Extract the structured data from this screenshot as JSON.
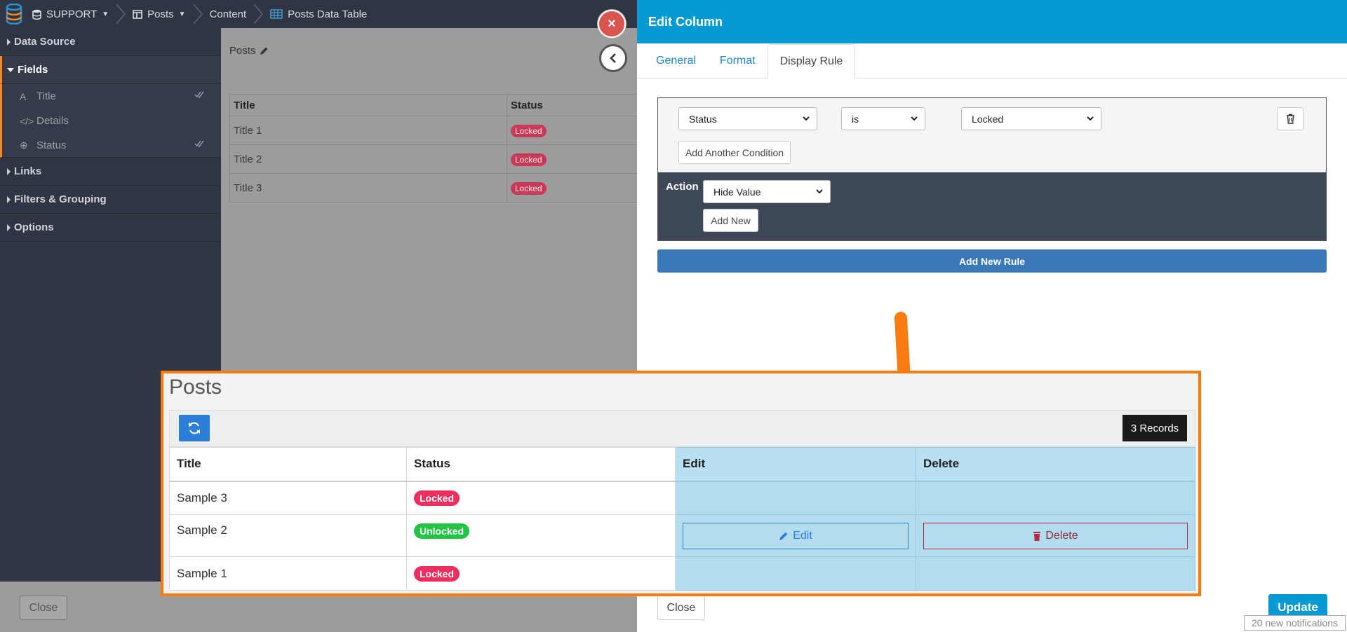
{
  "breadcrumb": {
    "app": "SUPPORT",
    "module": "Posts",
    "section": "Content",
    "page": "Posts Data Table"
  },
  "sidebar": {
    "data_source": "Data Source",
    "fields": "Fields",
    "field_items": [
      "Title",
      "Details",
      "Status"
    ],
    "links": "Links",
    "filters": "Filters & Grouping",
    "options": "Options"
  },
  "canvas": {
    "title": "Posts",
    "headers": [
      "Title",
      "Status"
    ],
    "rows": [
      {
        "title": "Title 1",
        "status": "Locked"
      },
      {
        "title": "Title 2",
        "status": "Locked"
      },
      {
        "title": "Title 3",
        "status": "Locked"
      }
    ],
    "close_label": "Close"
  },
  "panel": {
    "title": "Edit Column",
    "tabs": [
      "General",
      "Format",
      "Display Rule"
    ],
    "active_tab": "Display Rule",
    "condition_field": "Status",
    "condition_operator": "is",
    "condition_value": "Locked",
    "add_condition": "Add Another Condition",
    "action_label": "Action",
    "action_value": "Hide Value",
    "add_new": "Add New",
    "add_rule": "Add New Rule",
    "close_label": "Close",
    "update_label": "Update",
    "notifications": "20 new notifications"
  },
  "preview": {
    "title": "Posts",
    "records": "3 Records",
    "headers": [
      "Title",
      "Status",
      "Edit",
      "Delete"
    ],
    "rows": [
      {
        "title": "Sample 3",
        "status": "Locked"
      },
      {
        "title": "Sample 2",
        "status": "Unlocked",
        "edit": "Edit",
        "delete": "Delete"
      },
      {
        "title": "Sample 1",
        "status": "Locked"
      }
    ]
  },
  "colors": {
    "panel_header": "#069ad3",
    "callout_border": "#f97c10",
    "locked": "#ee2e5e",
    "unlocked": "#23c443",
    "highlight": "#b3dcee"
  }
}
